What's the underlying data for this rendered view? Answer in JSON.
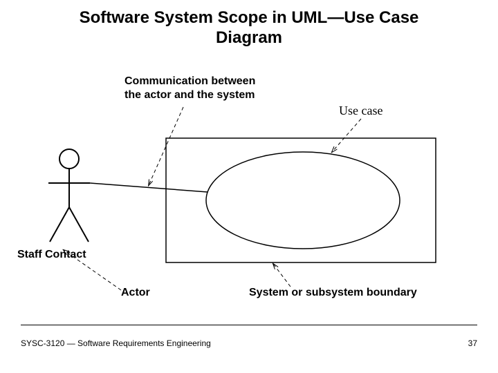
{
  "title_line1": "Software System Scope in UML—Use Case",
  "title_line2": "Diagram",
  "labels": {
    "communication_line1": "Communication between",
    "communication_line2": "the actor and the system",
    "use_case": "Use case",
    "staff_contact": "Staff Contact",
    "actor": "Actor",
    "boundary": "System or subsystem boundary"
  },
  "footer": {
    "left": "SYSC-3120 — Software Requirements Engineering",
    "page": "37"
  }
}
